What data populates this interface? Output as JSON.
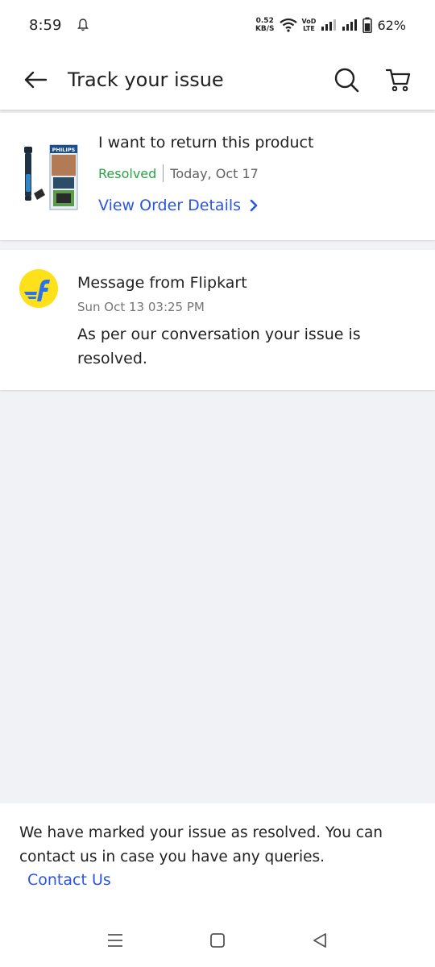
{
  "status_bar": {
    "time": "8:59",
    "net_speed_value": "0.52",
    "net_speed_unit": "KB/S",
    "volte_top": "VoD",
    "volte_bottom": "LTE",
    "battery": "62%"
  },
  "app_bar": {
    "title": "Track your issue",
    "icons": [
      "back-arrow-icon",
      "search-icon",
      "cart-icon"
    ]
  },
  "issue": {
    "title": "I want to return this product",
    "status": "Resolved",
    "date": "Today, Oct 17",
    "view_order_label": "View Order Details",
    "product_brand": "PHILIPS"
  },
  "message": {
    "from": "Message from Flipkart",
    "date": "Sun Oct 13 03:25 PM",
    "body": "As per our conversation your issue is resolved."
  },
  "footer_note": {
    "text": "We have marked your issue as resolved. You can contact us in case you have any queries.",
    "contact_label": "Contact Us"
  },
  "colors": {
    "accent_blue": "#2a55e5",
    "resolved_green": "#26a541",
    "flipkart_yellow": "#ffe11b",
    "flipkart_blue": "#2874f0"
  }
}
